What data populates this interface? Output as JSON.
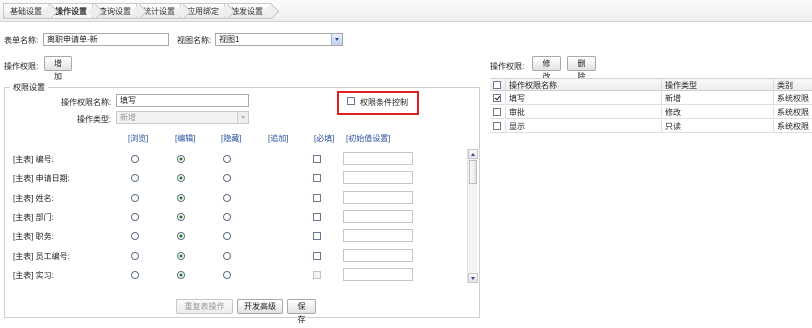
{
  "tabs": [
    {
      "label": "基础设置",
      "active": false
    },
    {
      "label": "操作设置",
      "active": true
    },
    {
      "label": "查询设置",
      "active": false
    },
    {
      "label": "统计设置",
      "active": false
    },
    {
      "label": "应用绑定",
      "active": false
    },
    {
      "label": "触发设置",
      "active": false
    }
  ],
  "form": {
    "form_name_label": "表单名称:",
    "form_name_value": "离职申请单-新",
    "view_name_label": "视图名称:",
    "view_name_value": "视图1"
  },
  "left": {
    "op_permission_label": "操作权限:",
    "add_button": "增加",
    "fieldset_legend": "权限设置",
    "perm_name_label": "操作权限名称:",
    "perm_name_value": "填写",
    "op_type_label": "操作类型:",
    "op_type_value": "新增",
    "condition_control_label": "权限条件控制",
    "condition_control_checked": false,
    "columns": [
      "[浏览]",
      "[编辑]",
      "[隐藏]",
      "[追加]",
      "[必填]",
      "[初始值设置]"
    ],
    "rows": [
      {
        "label": "[主表] 编号:",
        "choice": "edit",
        "required": false,
        "required_disabled": false
      },
      {
        "label": "[主表] 申请日期:",
        "choice": "edit",
        "required": false,
        "required_disabled": false
      },
      {
        "label": "[主表] 姓名:",
        "choice": "edit",
        "required": false,
        "required_disabled": false
      },
      {
        "label": "[主表] 部门:",
        "choice": "edit",
        "required": false,
        "required_disabled": false
      },
      {
        "label": "[主表] 职务:",
        "choice": "edit",
        "required": false,
        "required_disabled": false
      },
      {
        "label": "[主表] 员工编号:",
        "choice": "edit",
        "required": false,
        "required_disabled": false
      },
      {
        "label": "[主表] 实习:",
        "choice": "edit",
        "required": false,
        "required_disabled": true
      }
    ],
    "buttons": {
      "repeat_table_op": "重复表操作",
      "dev_advanced": "开发高级",
      "save": "保存"
    }
  },
  "right": {
    "op_permission_label": "操作权限:",
    "modify_button": "修改",
    "delete_button": "删除",
    "headers": [
      "操作权限名称",
      "操作类型",
      "类别"
    ],
    "rows": [
      {
        "checked": true,
        "name": "填写",
        "type": "新增",
        "category": "系统权限"
      },
      {
        "checked": false,
        "name": "审批",
        "type": "修改",
        "category": "系统权限"
      },
      {
        "checked": false,
        "name": "显示",
        "type": "只读",
        "category": "系统权限"
      }
    ]
  },
  "colors": {
    "accent_link": "#2850a0",
    "highlight_border": "#e02020",
    "radio_dot": "#1a7a1a"
  }
}
